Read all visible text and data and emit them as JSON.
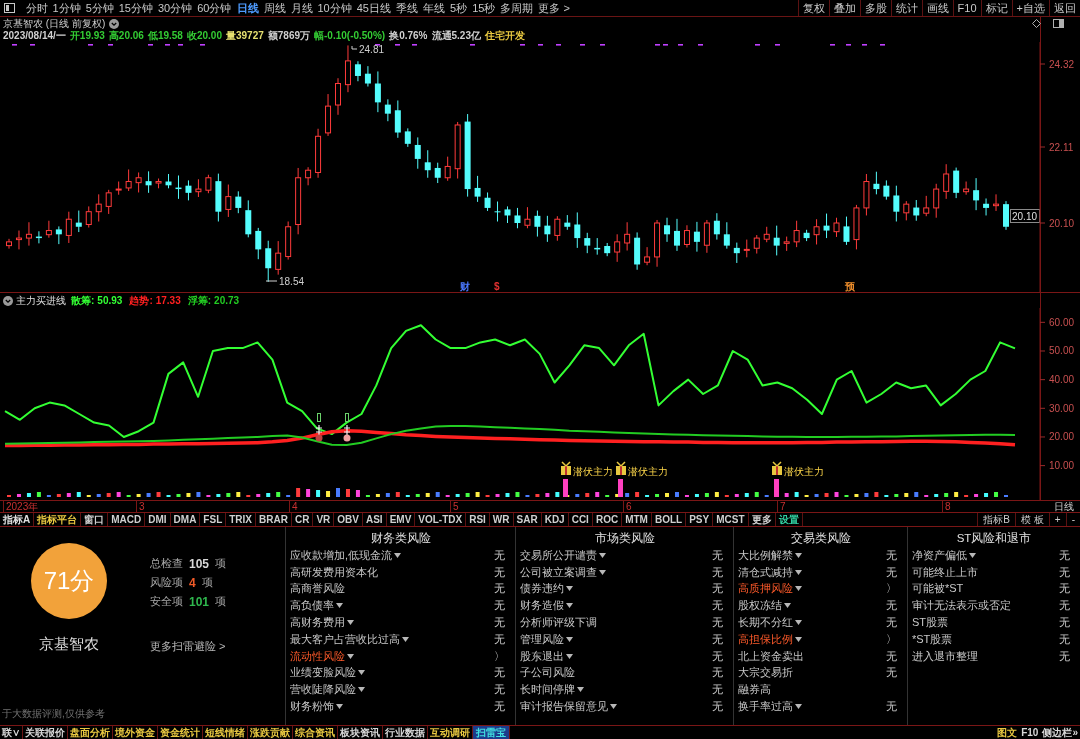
{
  "toolbar": {
    "periods": [
      {
        "label": "分时",
        "selected": false
      },
      {
        "label": "1分钟",
        "selected": false
      },
      {
        "label": "5分钟",
        "selected": false
      },
      {
        "label": "15分钟",
        "selected": false
      },
      {
        "label": "30分钟",
        "selected": false
      },
      {
        "label": "60分钟",
        "selected": false
      },
      {
        "label": "日线",
        "selected": true
      },
      {
        "label": "周线",
        "selected": false
      },
      {
        "label": "月线",
        "selected": false
      },
      {
        "label": "10分钟",
        "selected": false
      },
      {
        "label": "45日线",
        "selected": false
      },
      {
        "label": "季线",
        "selected": false
      },
      {
        "label": "年线",
        "selected": false
      },
      {
        "label": "5秒",
        "selected": false
      },
      {
        "label": "15秒",
        "selected": false
      },
      {
        "label": "多周期",
        "selected": false
      },
      {
        "label": "更多 >",
        "selected": false
      }
    ],
    "actions": [
      "复权",
      "叠加",
      "多股",
      "统计",
      "画线",
      "F10",
      "标记",
      "+自选",
      "返回"
    ]
  },
  "chart": {
    "title": "京基智农 (日线 前复权)",
    "quote": [
      {
        "text": "2023/08/14/一",
        "color": "#d0d0d0"
      },
      {
        "text": "开19.93",
        "color": "#33cc33"
      },
      {
        "text": "高20.06",
        "color": "#33cc33"
      },
      {
        "text": "低19.58",
        "color": "#33cc33"
      },
      {
        "text": "收20.00",
        "color": "#33cc33"
      },
      {
        "text": "量39727",
        "color": "#e6e070"
      },
      {
        "text": "额7869万",
        "color": "#d0d0d0"
      },
      {
        "text": "幅-0.10(-0.50%)",
        "color": "#33cc33"
      },
      {
        "text": "换0.76%",
        "color": "#d0d0d0"
      },
      {
        "text": "流通5.23亿",
        "color": "#d0d0d0"
      },
      {
        "text": "住宅开发",
        "color": "#e8c840"
      }
    ],
    "price_axis": [
      "24.32",
      "22.11",
      "20.10"
    ],
    "high_label": "24.81",
    "low_label": "18.54",
    "last_price": "20.10",
    "event_markers": [
      {
        "label": "财",
        "color": "#4a78ff"
      },
      {
        "label": "$",
        "color": "#e03030"
      },
      {
        "label": "预",
        "color": "#e88a2a"
      }
    ]
  },
  "indicator": {
    "name": "主力买进线",
    "legend": [
      {
        "value": "50.93"
      },
      {
        "value": "17.33"
      },
      {
        "value": "20.73"
      }
    ],
    "signals": [
      {
        "label": "潜伏主力"
      },
      {
        "label": "潜伏主力"
      },
      {
        "label": "潜伏主力"
      }
    ],
    "chart_data": {
      "type": "line",
      "series": [
        {
          "name": "散筹:",
          "color": "#33ff33",
          "values": [
            29,
            26,
            30,
            32,
            31,
            28,
            25,
            24,
            20,
            22,
            25,
            42,
            46,
            34,
            50,
            51,
            51,
            53,
            47,
            32,
            29,
            23,
            21,
            25,
            28,
            38,
            51,
            57,
            59,
            54,
            51,
            51,
            53,
            54,
            52,
            54,
            49,
            39,
            45,
            52,
            51,
            45,
            52,
            56,
            31,
            36,
            40,
            35,
            38,
            50,
            47,
            38,
            39,
            37,
            33,
            28,
            40,
            43,
            32,
            35,
            39,
            37,
            38,
            31,
            35,
            40,
            43,
            53,
            50.9
          ]
        },
        {
          "name": "趋势:",
          "color": "#ff2020",
          "values": [
            17,
            17,
            17.1,
            17.1,
            17.2,
            17.2,
            17.3,
            17.3,
            17.4,
            17.4,
            17.5,
            17.5,
            17.6,
            17.6,
            17.7,
            17.8,
            17.9,
            18,
            18.3,
            18.8,
            19.6,
            20.8,
            21.8,
            22.2,
            22,
            21.6,
            21.2,
            20.8,
            20.5,
            20.2,
            20,
            19.8,
            19.6,
            19.5,
            19.4,
            19.2,
            19,
            18.9,
            18.8,
            18.7,
            18.6,
            18.5,
            18.4,
            18.3,
            18.3,
            18.2,
            18.2,
            18.1,
            18.1,
            18,
            18,
            18,
            18,
            18,
            18.1,
            18.1,
            18.2,
            18.2,
            18.3,
            18.3,
            18.4,
            18.5,
            18.5,
            18.4,
            18.3,
            18.1,
            17.9,
            17.6,
            17.3
          ]
        },
        {
          "name": "浮筹:",
          "color": "#22cc22",
          "values": [
            17.6,
            17.7,
            17.8,
            17.9,
            18,
            18.1,
            18.2,
            18.3,
            18.4,
            18.5,
            18.6,
            18.8,
            19,
            19.2,
            19.4,
            19.6,
            19.8,
            20,
            20.3,
            20.5,
            19.8,
            18.5,
            17.3,
            17.2,
            18,
            19.5,
            21,
            22.2,
            23,
            23.6,
            23.8,
            23.8,
            23.6,
            23.4,
            23.2,
            23,
            22.8,
            22.5,
            22.2,
            22,
            21.8,
            21.6,
            21.4,
            21.2,
            21,
            20.9,
            20.8,
            20.6,
            20.5,
            20.4,
            20.3,
            20.2,
            20.1,
            20.1,
            20,
            20,
            20,
            20.1,
            20.1,
            20.2,
            20.2,
            20.3,
            20.4,
            20.5,
            20.6,
            20.7,
            20.8,
            20.8,
            20.7
          ]
        }
      ],
      "ylim": [
        -2,
        65
      ],
      "yticks": [
        {
          "value": 60,
          "label": "60.00"
        },
        {
          "value": 50,
          "label": "50.00"
        },
        {
          "value": 40,
          "label": "40.00"
        },
        {
          "value": 30,
          "label": "30.00"
        },
        {
          "value": 20,
          "label": "20.00"
        },
        {
          "value": 10,
          "label": "10.00"
        }
      ]
    }
  },
  "date_axis": [
    "2023年",
    "3",
    "4",
    "5",
    "6",
    "7",
    "8"
  ],
  "period_label": "日线",
  "indicator_tabs": [
    {
      "label": "指标A",
      "color": "#e0e0e0"
    },
    {
      "label": "指标平台",
      "color": "#e8c840"
    },
    {
      "label": "窗口",
      "color": "#d0d0d0"
    },
    {
      "label": "MACD",
      "color": "#d0d0d0"
    },
    {
      "label": "DMI",
      "color": "#d0d0d0"
    },
    {
      "label": "DMA",
      "color": "#d0d0d0"
    },
    {
      "label": "FSL",
      "color": "#d0d0d0"
    },
    {
      "label": "TRIX",
      "color": "#d0d0d0"
    },
    {
      "label": "BRAR",
      "color": "#d0d0d0"
    },
    {
      "label": "CR",
      "color": "#d0d0d0"
    },
    {
      "label": "VR",
      "color": "#d0d0d0"
    },
    {
      "label": "OBV",
      "color": "#d0d0d0"
    },
    {
      "label": "ASI",
      "color": "#d0d0d0"
    },
    {
      "label": "EMV",
      "color": "#d0d0d0"
    },
    {
      "label": "VOL-TDX",
      "color": "#d0d0d0"
    },
    {
      "label": "RSI",
      "color": "#d0d0d0"
    },
    {
      "label": "WR",
      "color": "#d0d0d0"
    },
    {
      "label": "SAR",
      "color": "#d0d0d0"
    },
    {
      "label": "KDJ",
      "color": "#d0d0d0"
    },
    {
      "label": "CCI",
      "color": "#d0d0d0"
    },
    {
      "label": "ROC",
      "color": "#d0d0d0"
    },
    {
      "label": "MTM",
      "color": "#d0d0d0"
    },
    {
      "label": "BOLL",
      "color": "#d0d0d0"
    },
    {
      "label": "PSY",
      "color": "#d0d0d0"
    },
    {
      "label": "MCST",
      "color": "#d0d0d0"
    },
    {
      "label": "更多",
      "color": "#d0d0d0"
    },
    {
      "label": "设置",
      "color": "#30d0a0"
    }
  ],
  "indicator_tabs_right": [
    "指标B",
    "模 板",
    "+",
    "-"
  ],
  "risk_panel": {
    "score": "71分",
    "stock": "京基智农",
    "stats": [
      {
        "label": "总检查",
        "value": "105",
        "unit": "项",
        "color": "#d8d8d8"
      },
      {
        "label": "风险项",
        "value": "4",
        "unit": "项",
        "color": "#f05a28"
      },
      {
        "label": "安全项",
        "value": "101",
        "unit": "项",
        "color": "#2fb84e"
      }
    ],
    "more_link": "更多扫雷避险 >",
    "disclaimer": "于大数据评测,仅供参考",
    "columns": [
      {
        "title": "财务类风险",
        "items": [
          {
            "label": "应收款增加,低现金流",
            "dropdown": true,
            "flagged": false,
            "value": "无"
          },
          {
            "label": "高研发费用资本化",
            "dropdown": false,
            "flagged": false,
            "value": "无"
          },
          {
            "label": "高商誉风险",
            "dropdown": false,
            "flagged": false,
            "value": "无"
          },
          {
            "label": "高负债率",
            "dropdown": true,
            "flagged": false,
            "value": "无"
          },
          {
            "label": "高财务费用",
            "dropdown": true,
            "flagged": false,
            "value": "无"
          },
          {
            "label": "最大客户占营收比过高",
            "dropdown": true,
            "flagged": false,
            "value": "无"
          },
          {
            "label": "流动性风险",
            "dropdown": true,
            "flagged": true,
            "value": "〉"
          },
          {
            "label": "业绩变脸风险",
            "dropdown": true,
            "flagged": false,
            "value": "无"
          },
          {
            "label": "营收陡降风险",
            "dropdown": true,
            "flagged": false,
            "value": "无"
          },
          {
            "label": "财务粉饰",
            "dropdown": true,
            "flagged": false,
            "value": "无"
          }
        ]
      },
      {
        "title": "市场类风险",
        "items": [
          {
            "label": "交易所公开谴责",
            "dropdown": true,
            "flagged": false,
            "value": "无"
          },
          {
            "label": "公司被立案调查",
            "dropdown": true,
            "flagged": false,
            "value": "无"
          },
          {
            "label": "债券违约",
            "dropdown": true,
            "flagged": false,
            "value": "无"
          },
          {
            "label": "财务造假",
            "dropdown": true,
            "flagged": false,
            "value": "无"
          },
          {
            "label": "分析师评级下调",
            "dropdown": false,
            "flagged": false,
            "value": "无"
          },
          {
            "label": "管理风险",
            "dropdown": true,
            "flagged": false,
            "value": "无"
          },
          {
            "label": "股东退出",
            "dropdown": true,
            "flagged": false,
            "value": "无"
          },
          {
            "label": "子公司风险",
            "dropdown": false,
            "flagged": false,
            "value": "无"
          },
          {
            "label": "长时间停牌",
            "dropdown": true,
            "flagged": false,
            "value": "无"
          },
          {
            "label": "审计报告保留意见",
            "dropdown": true,
            "flagged": false,
            "value": "无"
          }
        ]
      },
      {
        "title": "交易类风险",
        "items": [
          {
            "label": "大比例解禁",
            "dropdown": true,
            "flagged": false,
            "value": "无"
          },
          {
            "label": "清仓式减持",
            "dropdown": true,
            "flagged": false,
            "value": "无"
          },
          {
            "label": "高质押风险",
            "dropdown": true,
            "flagged": true,
            "value": "〉"
          },
          {
            "label": "股权冻结",
            "dropdown": true,
            "flagged": false,
            "value": "无"
          },
          {
            "label": "长期不分红",
            "dropdown": true,
            "flagged": false,
            "value": "无"
          },
          {
            "label": "高担保比例",
            "dropdown": true,
            "flagged": true,
            "value": "〉"
          },
          {
            "label": "北上资金卖出",
            "dropdown": false,
            "flagged": false,
            "value": "无"
          },
          {
            "label": "大宗交易折",
            "dropdown": false,
            "flagged": false,
            "value": "无"
          },
          {
            "label": "融券高",
            "dropdown": false,
            "flagged": false
          },
          {
            "label": "换手率过高",
            "dropdown": true,
            "flagged": false,
            "value": "无"
          }
        ]
      },
      {
        "title": "ST风险和退市",
        "items": [
          {
            "label": "净资产偏低",
            "dropdown": true,
            "flagged": false,
            "value": "无"
          },
          {
            "label": "可能终止上市",
            "dropdown": false,
            "flagged": false,
            "value": "无"
          },
          {
            "label": "可能被*ST",
            "dropdown": false,
            "flagged": false,
            "value": "无"
          },
          {
            "label": "审计无法表示或否定",
            "dropdown": false,
            "flagged": false,
            "value": "无"
          },
          {
            "label": "ST股票",
            "dropdown": false,
            "flagged": false,
            "value": "无"
          },
          {
            "label": "*ST股票",
            "dropdown": false,
            "flagged": false,
            "value": "无"
          },
          {
            "label": "进入退市整理",
            "dropdown": false,
            "flagged": false,
            "value": "无"
          }
        ]
      }
    ]
  },
  "bottom_tabs": [
    {
      "label": "联∨",
      "selected": false,
      "color": "#d8d8d8"
    },
    {
      "label": "关联报价",
      "selected": false,
      "color": "#d8d8d8"
    },
    {
      "label": "盘面分析",
      "selected": false,
      "color": "#e8c840"
    },
    {
      "label": "境外资金",
      "selected": false,
      "color": "#e8c840"
    },
    {
      "label": "资金统计",
      "selected": false,
      "color": "#e8c840"
    },
    {
      "label": "短线情绪",
      "selected": false,
      "color": "#e8c840"
    },
    {
      "label": "涨跌贡献",
      "selected": false,
      "color": "#e8c840"
    },
    {
      "label": "综合资讯",
      "selected": false,
      "color": "#e8c840"
    },
    {
      "label": "板块资讯",
      "selected": false,
      "color": "#d8d8d8"
    },
    {
      "label": "行业数据",
      "selected": false,
      "color": "#d8d8d8"
    },
    {
      "label": "互动调研",
      "selected": false,
      "color": "#e8c840"
    },
    {
      "label": "扫雷宝",
      "selected": true
    }
  ],
  "bottom_right": [
    {
      "label": "图文",
      "color": "#e8c840"
    },
    {
      "label": "F10",
      "color": "#d8d8d8"
    },
    {
      "label": "侧边栏»",
      "color": "#d8d8d8"
    }
  ]
}
